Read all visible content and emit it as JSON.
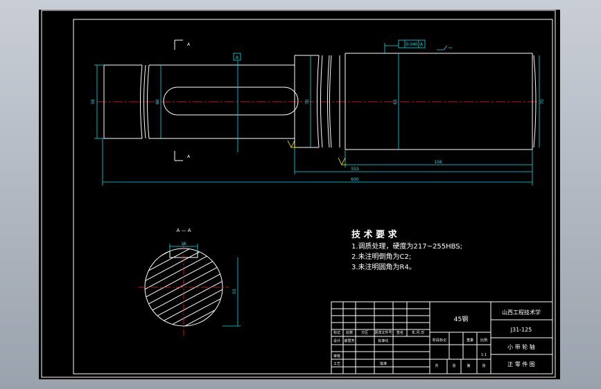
{
  "drawing": {
    "dimensions": {
      "d_left": "38",
      "d_key": "60",
      "d_collar": "70",
      "d_body": "65",
      "d_right": "70",
      "len_body": "156",
      "len_mid": "553",
      "len_total": "600",
      "tolerance": "0.040",
      "datum": "A",
      "section_width": "16",
      "section_depth": "55",
      "cut_a": "A"
    },
    "section_label": "A — A",
    "tech_title": "技 术 要 求",
    "tech_lines": [
      "1.调质处理，硬度为217~255HBS;",
      "2.未注明倒角为C2;",
      "3.未注明圆角为R4。"
    ]
  },
  "title_block": {
    "material": "45钢",
    "school": "山西工程技术学",
    "drawing_no": "J31-125",
    "part_name": "小 带 轮 轴",
    "drawing_type": "正 零 件 图",
    "row_labels": [
      "标记",
      "处数",
      "分区",
      "更改文件号",
      "签名",
      "年.月.日"
    ],
    "design": "设计",
    "standardize": "标准化",
    "review": "审核",
    "process": "工艺",
    "approve": "批准",
    "stage": "阶段标记",
    "weight": "重量",
    "scale": "比例",
    "scale_val": "1:1",
    "sheets": [
      "共",
      "张",
      "第",
      "张"
    ],
    "design_name": "郝慧芳"
  }
}
